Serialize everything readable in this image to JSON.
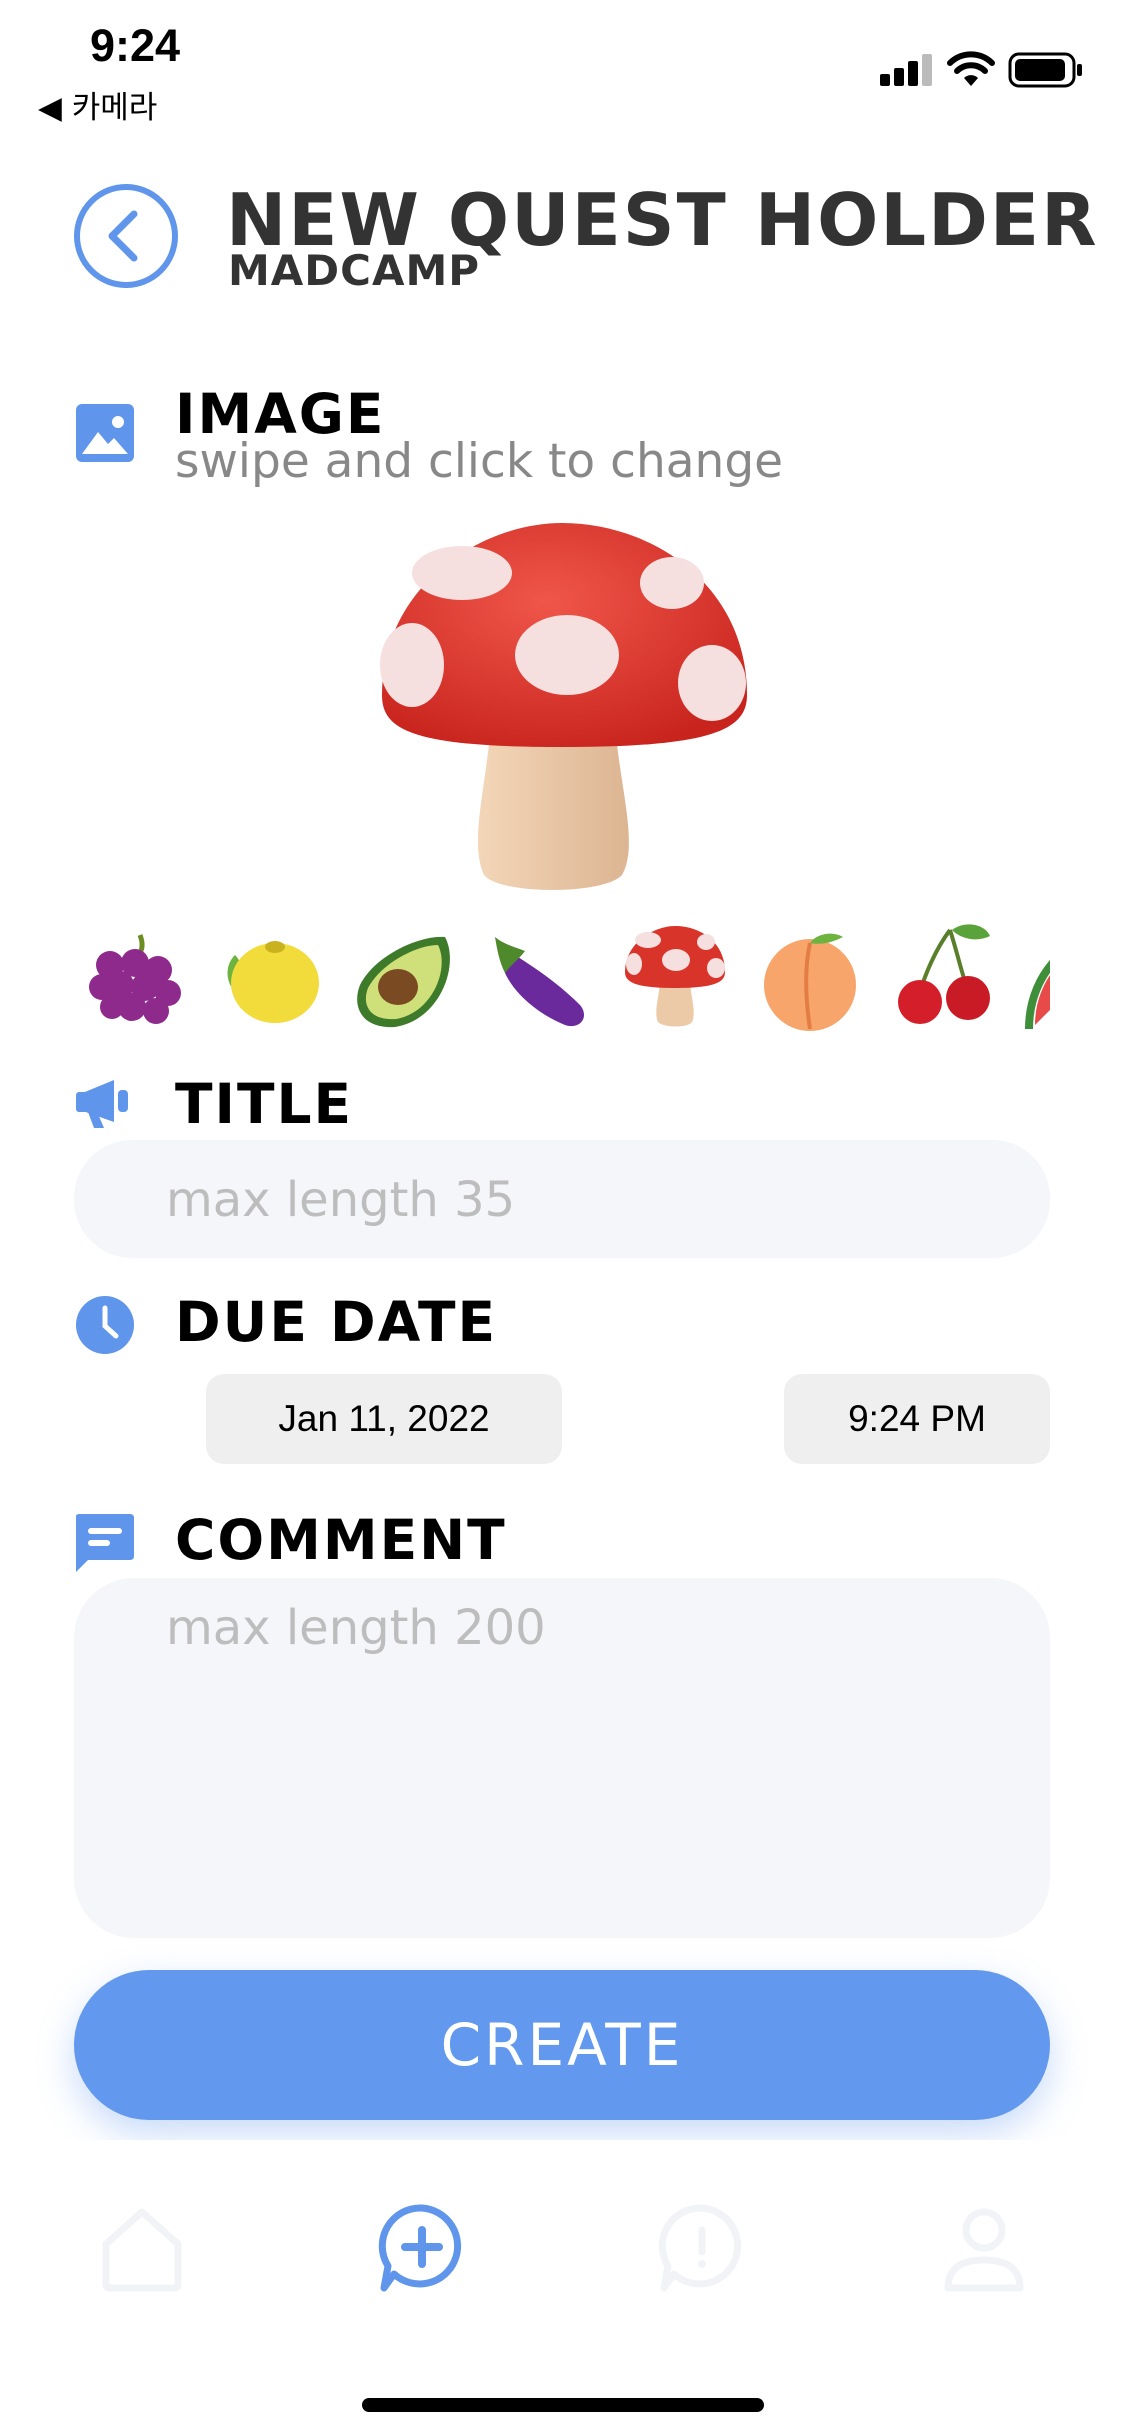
{
  "status_bar": {
    "time": "9:24",
    "back_app": "◀ 카메라"
  },
  "header": {
    "title": "NEW QUEST HOLDER",
    "subtitle": "MADCAMP"
  },
  "image_section": {
    "label": "IMAGE",
    "hint": "swipe and click to change",
    "selected_icon": "mushroom-emoji",
    "options": [
      "grapes-emoji",
      "lemon-emoji",
      "avocado-emoji",
      "eggplant-emoji",
      "mushroom-emoji",
      "peach-emoji",
      "cherries-emoji",
      "watermelon-emoji"
    ]
  },
  "title_section": {
    "label": "TITLE",
    "placeholder": "max length 35"
  },
  "due_date_section": {
    "label": "DUE DATE",
    "date": "Jan 11, 2022",
    "time": "9:24 PM"
  },
  "comment_section": {
    "label": "COMMENT",
    "placeholder": "max length 200"
  },
  "actions": {
    "create_label": "CREATE"
  },
  "tab_bar": {
    "active": "new-quest-icon",
    "tabs": [
      "home-icon",
      "new-quest-icon",
      "chat-icon",
      "profile-icon"
    ]
  },
  "colors": {
    "accent": "#6299ee",
    "field_bg": "#f4f6fa",
    "pill_bg": "#efefef"
  }
}
